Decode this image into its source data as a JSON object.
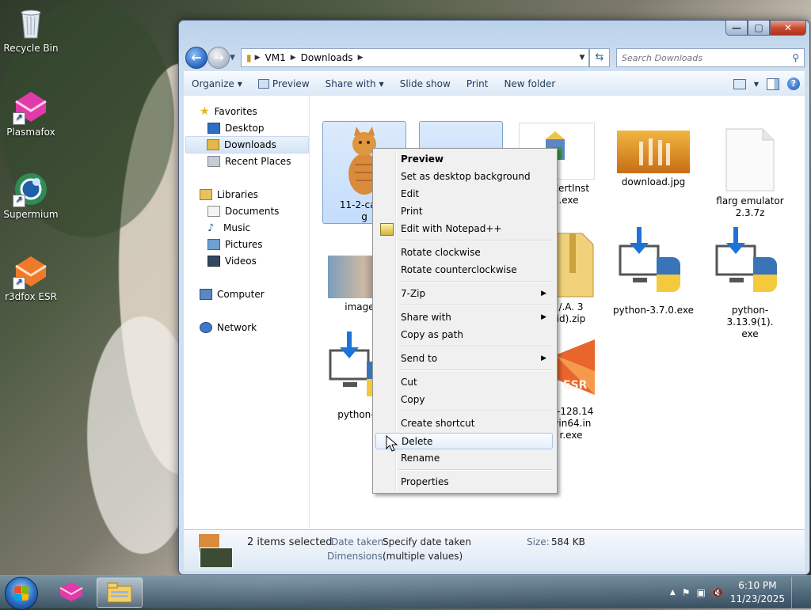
{
  "desktop": {
    "icons": [
      {
        "label": "Recycle Bin",
        "icon": "recycle-bin-icon"
      },
      {
        "label": "Plasmafox",
        "icon": "plasmafox-icon"
      },
      {
        "label": "Supermium",
        "icon": "supermium-icon"
      },
      {
        "label": "r3dfox ESR",
        "icon": "r3dfox-icon"
      }
    ]
  },
  "window": {
    "caption": {
      "min": "—",
      "max": "▢",
      "close": "✕"
    },
    "address": {
      "crumbs": [
        "VM1",
        "Downloads"
      ]
    },
    "search": {
      "placeholder": "Search Downloads"
    },
    "toolbar": {
      "organize": "Organize",
      "preview": "Preview",
      "share_with": "Share with",
      "slide_show": "Slide show",
      "print": "Print",
      "new_folder": "New folder"
    },
    "navpane": {
      "favorites": "Favorites",
      "desktop": "Desktop",
      "downloads": "Downloads",
      "recent_places": "Recent Places",
      "libraries": "Libraries",
      "documents": "Documents",
      "music": "Music",
      "pictures": "Pictures",
      "videos": "Videos",
      "computer": "Computer",
      "network": "Network"
    },
    "files": [
      {
        "name": "11-2-cat-p\ng",
        "kind": "cat-photo",
        "selected": true
      },
      {
        "name": "",
        "kind": "dark-photo",
        "selected": true
      },
      {
        "name": "tCertInst\n.exe",
        "kind": "installer-icon",
        "selected": false
      },
      {
        "name": "download.jpg",
        "kind": "dancers-photo",
        "selected": false
      },
      {
        "name": "flarg emulator\n2.3.7z",
        "kind": "blank-file-icon",
        "selected": false
      },
      {
        "name": "images.",
        "kind": "people-photo",
        "selected": false
      },
      {
        "name": "/.A. 3\nid).zip",
        "kind": "zip-icon",
        "selected": false
      },
      {
        "name": "python-3.7.0.exe",
        "kind": "python-installer-icon",
        "selected": false
      },
      {
        "name": "python-3.13.9(1).\nexe",
        "kind": "python-installer-icon",
        "selected": false
      },
      {
        "name": "python-3.1",
        "kind": "python-installer-icon",
        "selected": false
      },
      {
        "name": "sr-128.14\nwin64.in\nr.exe",
        "kind": "esr-installer-icon",
        "selected": false
      }
    ],
    "details": {
      "selected_count": "2 items selected",
      "date_taken_label": "Date taken:",
      "date_taken_value": "Specify date taken",
      "dimensions_label": "Dimensions:",
      "dimensions_value": "(multiple values)",
      "size_label": "Size:",
      "size_value": "584 KB"
    }
  },
  "context_menu": {
    "items": [
      {
        "label": "Preview",
        "bold": true
      },
      {
        "label": "Set as desktop background"
      },
      {
        "label": "Edit"
      },
      {
        "label": "Print"
      },
      {
        "label": "Edit with Notepad++",
        "icon": "notepad-plus-plus-icon"
      },
      {
        "label": "Rotate clockwise"
      },
      {
        "label": "Rotate counterclockwise"
      },
      {
        "label": "7-Zip",
        "submenu": true
      },
      {
        "label": "Share with",
        "submenu": true
      },
      {
        "label": "Copy as path"
      },
      {
        "label": "Send to",
        "submenu": true
      },
      {
        "label": "Cut"
      },
      {
        "label": "Copy"
      },
      {
        "label": "Create shortcut"
      },
      {
        "label": "Delete",
        "hover": true
      },
      {
        "label": "Rename"
      },
      {
        "label": "Properties"
      }
    ]
  },
  "taskbar": {
    "clock_time": "6:10 PM",
    "clock_date": "11/23/2025"
  },
  "colors": {
    "accent": "#2465c5",
    "selection": "#c4ddfc",
    "close_red": "#c74a2e"
  }
}
